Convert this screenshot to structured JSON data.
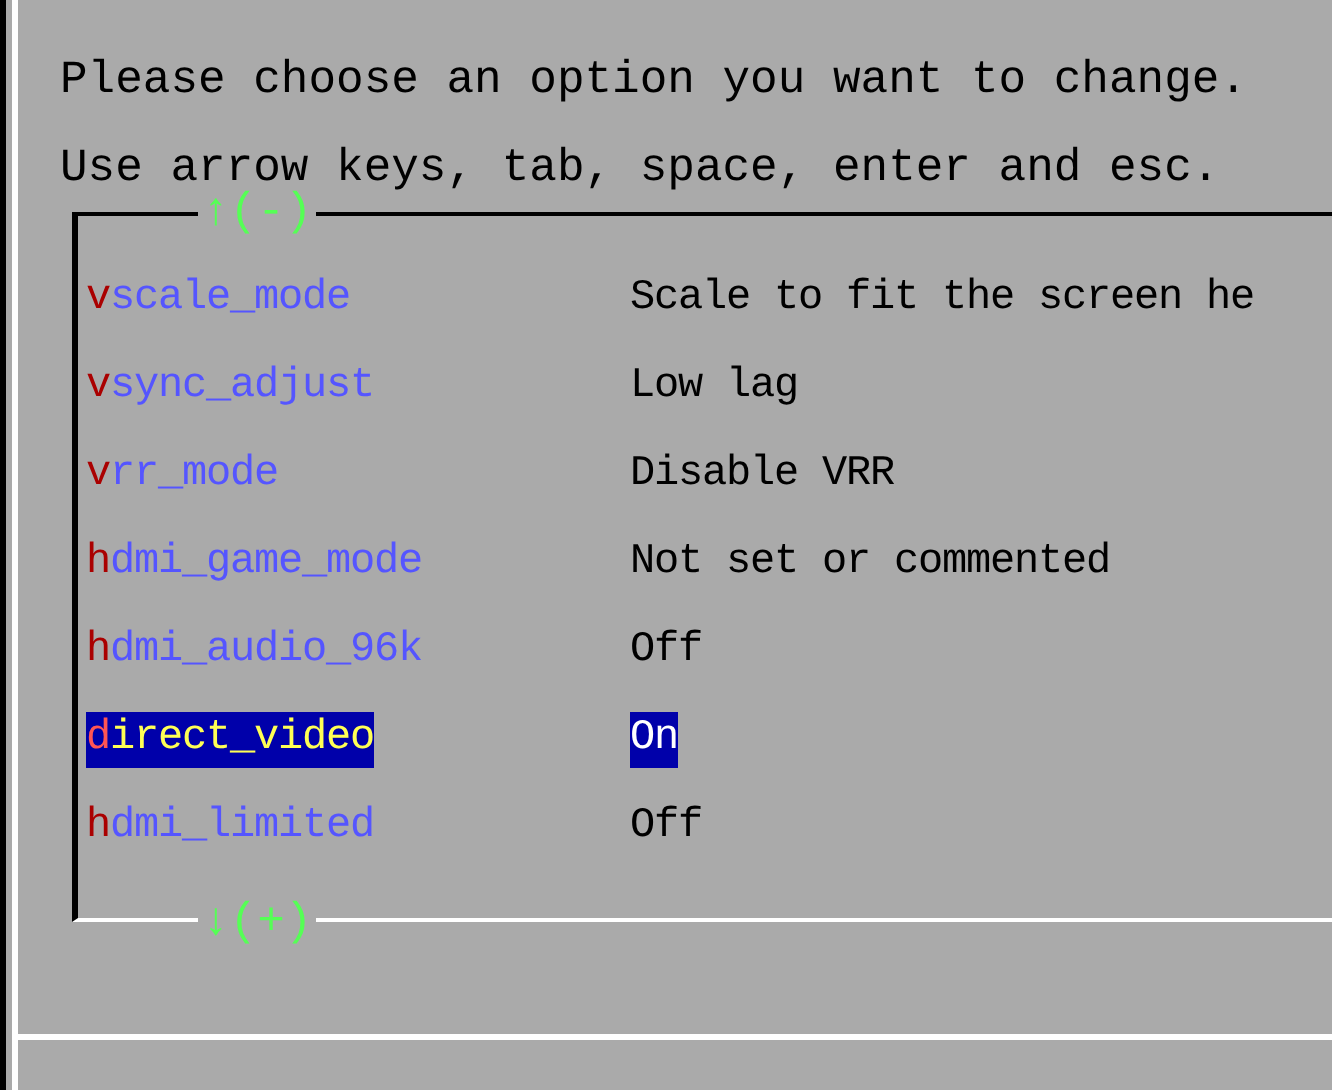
{
  "instructions": [
    "Please choose an option you want to change.",
    "Use arrow keys, tab, space, enter and esc."
  ],
  "scroll_up": "↑(-)",
  "scroll_down": "↓(+)",
  "options": [
    {
      "name": "vscale_mode",
      "value": "Scale to fit the screen he",
      "selected": false
    },
    {
      "name": "vsync_adjust",
      "value": "Low lag",
      "selected": false
    },
    {
      "name": "vrr_mode",
      "value": "Disable VRR",
      "selected": false
    },
    {
      "name": "hdmi_game_mode",
      "value": "Not set or commented",
      "selected": false
    },
    {
      "name": "hdmi_audio_96k",
      "value": "Off",
      "selected": false
    },
    {
      "name": "direct_video",
      "value": "On",
      "selected": true
    },
    {
      "name": "hdmi_limited",
      "value": "Off",
      "selected": false
    }
  ]
}
